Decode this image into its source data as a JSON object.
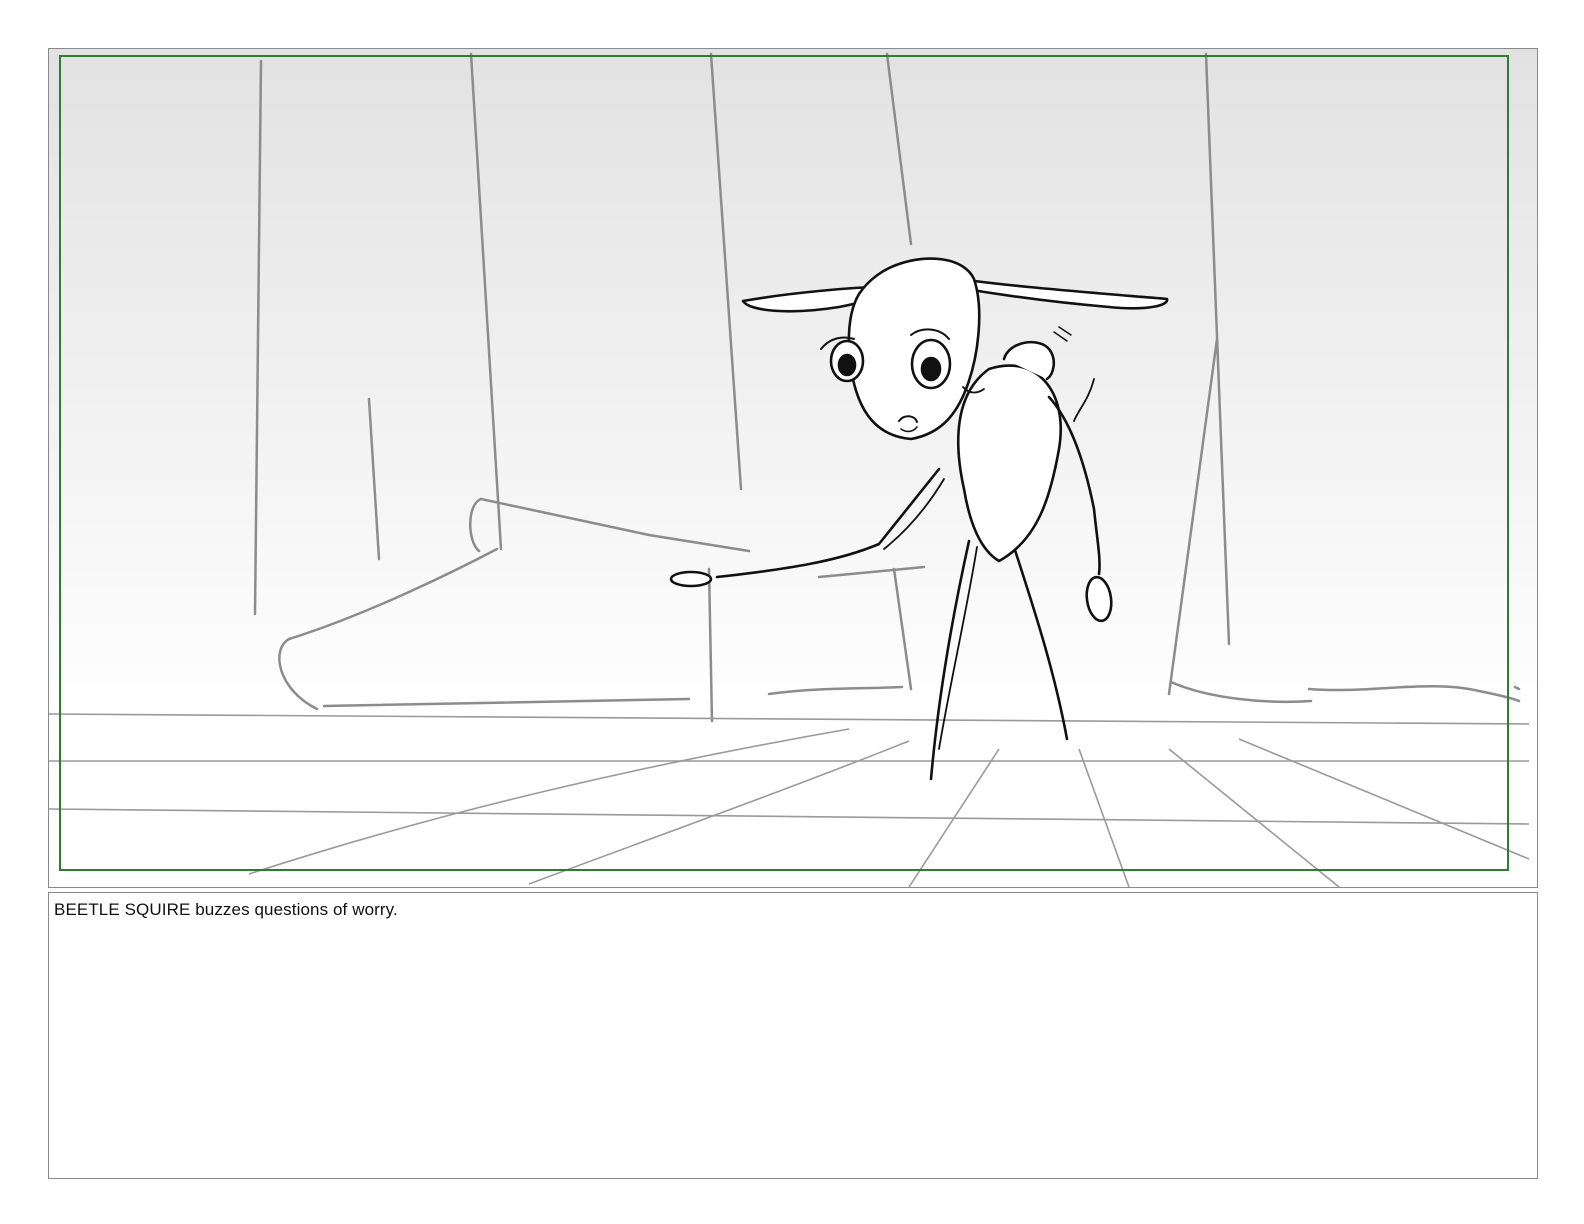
{
  "panel": {
    "safe_area_color": "#2e7d32",
    "background_top": "#e4e4e4",
    "background_bottom": "#ffffff",
    "ink_color": "#111111",
    "pencil_color": "#8c8c8c"
  },
  "illustration": {
    "subject": "beetle-squire",
    "expression": "worried"
  },
  "notes": {
    "action": "BEETLE SQUIRE buzzes questions of worry."
  }
}
